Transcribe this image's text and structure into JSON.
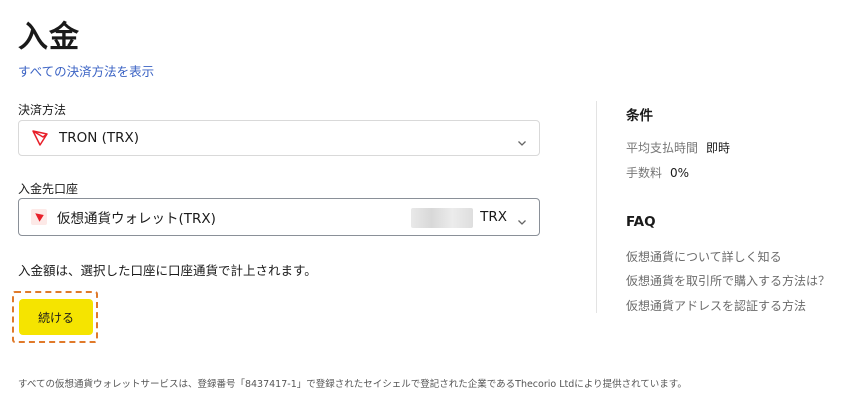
{
  "page": {
    "title": "入金",
    "show_all_methods": "すべての決済方法を表示"
  },
  "payment_method": {
    "label": "決済方法",
    "selected": "TRON (TRX)"
  },
  "deposit_account": {
    "label": "入金先口座",
    "selected": "仮想通貨ウォレット(TRX)",
    "currency": "TRX"
  },
  "info_text": "入金額は、選択した口座に口座通貨で計上されます。",
  "continue_label": "続ける",
  "conditions": {
    "title": "条件",
    "avg_payout_key": "平均支払時間",
    "avg_payout_val": "即時",
    "fee_key": "手数料",
    "fee_val": "0%"
  },
  "faq": {
    "title": "FAQ",
    "links": [
      "仮想通貨について詳しく知る",
      "仮想通貨を取引所で購入する方法は？",
      "仮想通貨アドレスを認証する方法"
    ]
  },
  "footer": "すべての仮想通貨ウォレットサービスは、登録番号「8437417-1」で登録されたセイシェルで登記された企業であるThecorio Ltdにより提供されています。",
  "colors": {
    "accent_button": "#f5e400",
    "link": "#3b63c4",
    "tron_red": "#e8202a",
    "highlight_dashed": "#e07a2a"
  }
}
